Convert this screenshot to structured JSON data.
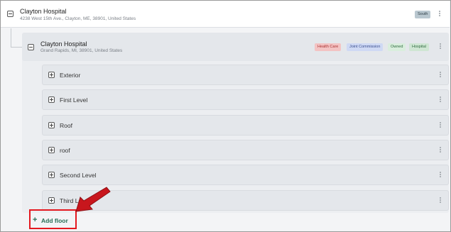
{
  "hospital": {
    "name": "Clayton Hospital",
    "address": "4238 West 15th Ave., Clayton, ME, 38901, United States",
    "badge": "South",
    "badge_color": "#b9c7cf"
  },
  "child": {
    "name": "Clayton Hospital",
    "address": "Grand Rapids, MI, 38901, United States",
    "tags": [
      {
        "label": "Health Care",
        "bg": "#f3c3c3",
        "fg": "#a33"
      },
      {
        "label": "Joint Commission",
        "bg": "#cfd9f4",
        "fg": "#3b4f8f"
      },
      {
        "label": "Owned",
        "bg": "#d9eedd",
        "fg": "#2f6b3f"
      },
      {
        "label": "Hospital",
        "bg": "#cfe6d3",
        "fg": "#2f6b3f"
      }
    ]
  },
  "floors": [
    {
      "label": "Exterior"
    },
    {
      "label": "First Level"
    },
    {
      "label": "Roof"
    },
    {
      "label": "roof"
    },
    {
      "label": "Second Level"
    },
    {
      "label": "Third Le"
    }
  ],
  "actions": {
    "add_floor_icon": "+",
    "add_floor_label": "Add floor"
  },
  "annotation": {
    "highlight_color": "#e4181f",
    "arrow_color": "#c8161d"
  }
}
